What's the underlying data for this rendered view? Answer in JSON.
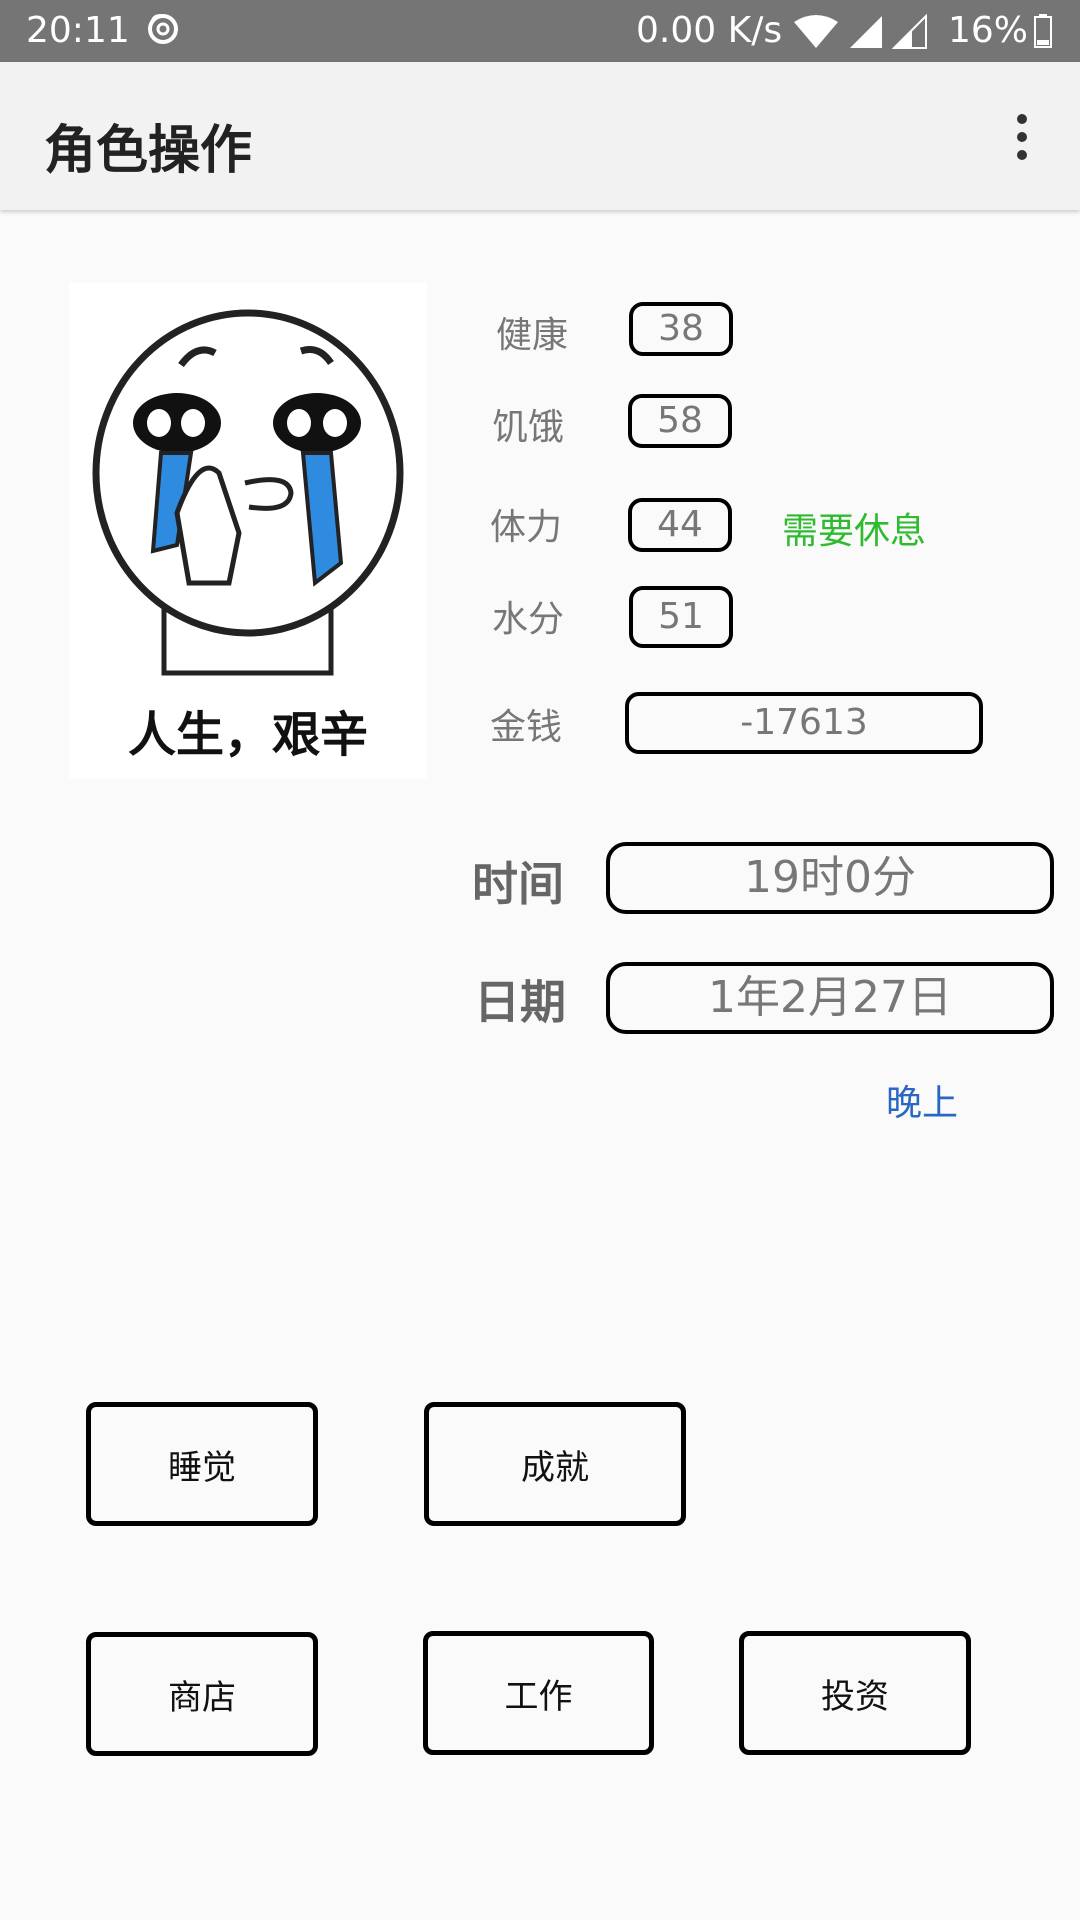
{
  "status_bar": {
    "time": "20:11",
    "net_speed": "0.00 K/s",
    "battery": "16%"
  },
  "app_bar": {
    "title": "角色操作"
  },
  "avatar": {
    "caption": "人生，艰辛"
  },
  "stats": {
    "health": {
      "label": "健康",
      "value": "38"
    },
    "hunger": {
      "label": "饥饿",
      "value": "58"
    },
    "stamina": {
      "label": "体力",
      "value": "44",
      "hint": "需要休息"
    },
    "water": {
      "label": "水分",
      "value": "51"
    },
    "money": {
      "label": "金钱",
      "value": "-17613"
    }
  },
  "time_info": {
    "time_label": "时间",
    "time_value": "19时0分",
    "date_label": "日期",
    "date_value": "1年2月27日",
    "period": "晚上"
  },
  "actions": {
    "sleep": "睡觉",
    "achievements": "成就",
    "shop": "商店",
    "work": "工作",
    "invest": "投资"
  },
  "colors": {
    "status_bar_bg": "#757575",
    "hint_green": "#2fbb2f",
    "period_blue": "#2a67c3"
  }
}
